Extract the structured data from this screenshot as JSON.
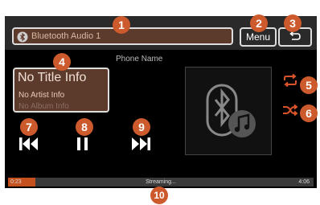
{
  "source": {
    "label": "Bluetooth Audio 1",
    "icon": "bluetooth-icon"
  },
  "header": {
    "menu_label": "Menu",
    "back_icon": "back-arrow-icon"
  },
  "device": {
    "phone_name": "Phone Name"
  },
  "track": {
    "title": "No Title Info",
    "artist": "No Artist Info",
    "album": "No Album Info"
  },
  "player": {
    "elapsed": "0:23",
    "duration": "4:06",
    "status": "Streaming...",
    "progress_fraction": 0.09
  },
  "callouts": {
    "c1": "1",
    "c2": "2",
    "c3": "3",
    "c4": "4",
    "c5": "5",
    "c6": "6",
    "c7": "7",
    "c8": "8",
    "c9": "9",
    "c10": "10"
  },
  "colors": {
    "accent": "#cc5a2c",
    "screen_bg": "#000000",
    "highlight_box": "#5d3b2c",
    "progress_fill": "#c5511f"
  }
}
